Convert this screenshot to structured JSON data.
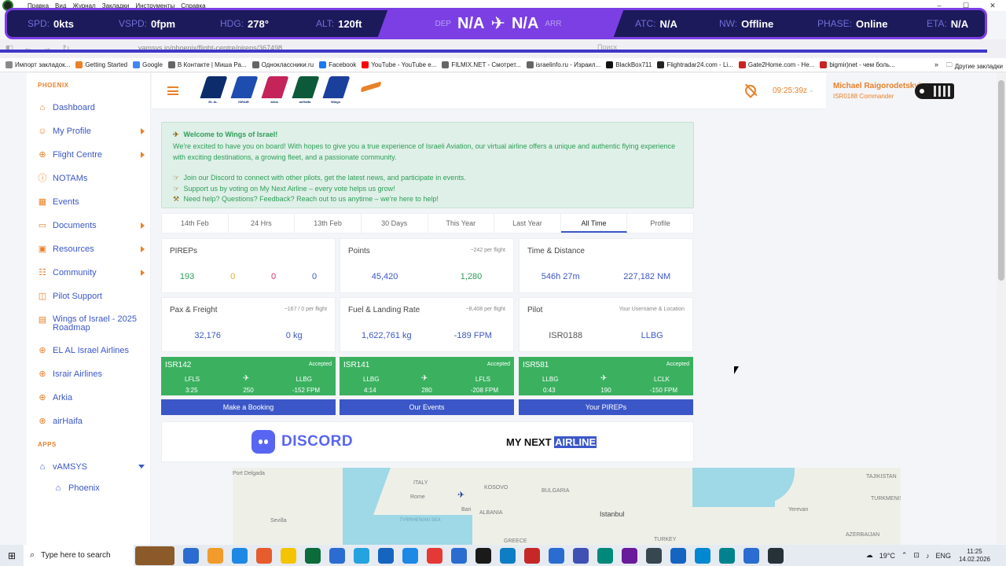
{
  "os_menu": {
    "items": [
      "Правка",
      "Вид",
      "Журнал",
      "Закладки",
      "Инструменты",
      "Справка"
    ]
  },
  "hud": {
    "spd_label": "SPD:",
    "spd_value": "0kts",
    "vspd_label": "VSPD:",
    "vspd_value": "0fpm",
    "hdg_label": "HDG:",
    "hdg_value": "278°",
    "alt_label": "ALT:",
    "alt_value": "120ft",
    "dep_label": "DEP",
    "dep_value": "N/A",
    "arr_label": "ARR",
    "arr_value": "N/A",
    "atc_label": "ATC:",
    "atc_value": "N/A",
    "nw_label": "NW:",
    "nw_value": "Offline",
    "phase_label": "PHASE:",
    "phase_value": "Online",
    "eta_label": "ETA:",
    "eta_value": "N/A"
  },
  "browser": {
    "url": "vamsys.io/phoenix/flight-centre/pireps/367498",
    "search_placeholder": "Поиск"
  },
  "bookmarks": {
    "items": [
      {
        "label": "Импорт закладок...",
        "color": "#8a8a8a"
      },
      {
        "label": "Getting Started",
        "color": "#e8812a"
      },
      {
        "label": "Google",
        "color": "#4285f4"
      },
      {
        "label": "В Контакте | Миша Ра...",
        "color": "#666666"
      },
      {
        "label": "Одноклассники.ru",
        "color": "#666666"
      },
      {
        "label": "Facebook",
        "color": "#1877f2"
      },
      {
        "label": "YouTube - YouTube е...",
        "color": "#ff0000"
      },
      {
        "label": "FILMIX.NET - Смотрет...",
        "color": "#666666"
      },
      {
        "label": "israelinfo.ru - Израил...",
        "color": "#666666"
      },
      {
        "label": "BlackBox711",
        "color": "#111111"
      },
      {
        "label": "Flightradar24.com - Li...",
        "color": "#222222"
      },
      {
        "label": "Gate2Home.com - Не...",
        "color": "#cc2222"
      },
      {
        "label": "bigmir)net - чем боль...",
        "color": "#cc2222"
      }
    ],
    "more": "»",
    "other_label": "Другие закладки"
  },
  "sidebar": {
    "section_main": "PHOENIX",
    "items": [
      {
        "label": "Dashboard",
        "icon": "home-icon",
        "arrow": false
      },
      {
        "label": "My Profile",
        "icon": "user-icon",
        "arrow": true
      },
      {
        "label": "Flight Centre",
        "icon": "globe-icon",
        "arrow": true
      },
      {
        "label": "NOTAMs",
        "icon": "alert-icon",
        "arrow": false
      },
      {
        "label": "Events",
        "icon": "calendar-icon",
        "arrow": false
      },
      {
        "label": "Documents",
        "icon": "folder-icon",
        "arrow": true
      },
      {
        "label": "Resources",
        "icon": "briefcase-icon",
        "arrow": true
      },
      {
        "label": "Community",
        "icon": "users-icon",
        "arrow": true
      },
      {
        "label": "Pilot Support",
        "icon": "support-icon",
        "arrow": false
      },
      {
        "label": "Wings of Israel - 2025 Roadmap",
        "icon": "grid-icon",
        "arrow": false
      },
      {
        "label": "EL AL Israel Airlines",
        "icon": "globe-icon",
        "arrow": false
      },
      {
        "label": "Israir Airlines",
        "icon": "globe-icon",
        "arrow": false
      },
      {
        "label": "Arkia",
        "icon": "globe-icon",
        "arrow": false
      },
      {
        "label": "airHaifa",
        "icon": "globe-icon",
        "arrow": false
      }
    ],
    "section_apps": "APPS",
    "apps": [
      {
        "label": "vAMSYS"
      },
      {
        "label": "Phoenix"
      }
    ]
  },
  "appbar": {
    "airlines": [
      {
        "name": "EL AL",
        "color": "#0d2c6c"
      },
      {
        "name": "ISRAIR",
        "color": "#1e4db0"
      },
      {
        "name": "arkia",
        "color": "#c4245a"
      },
      {
        "name": "airHaifa",
        "color": "#0d5a3a"
      },
      {
        "name": "Wings",
        "color": "#1b3f9c"
      }
    ],
    "time": "09:25:39z",
    "user_name": "Michael Raigorodetskyi",
    "user_role": "ISR0188 Commander"
  },
  "welcome": {
    "title": "Welcome to Wings of Israel!",
    "body": "We're excited to have you on board! With hopes to give you a true experience of Israeli Aviation, our virtual airline offers a unique and authentic flying experience with exciting destinations, a growing fleet, and a passionate community.",
    "line1": "Join our Discord to connect with other pilots, get the latest news, and participate in events.",
    "line2": "Support us by voting on My Next Airline – every vote helps us grow!",
    "line3": "Need help? Questions? Feedback? Reach out to us anytime – we're here to help!"
  },
  "period_tabs": {
    "items": [
      "14th Feb",
      "24 Hrs",
      "13th Feb",
      "30 Days",
      "This Year",
      "Last Year",
      "All Time",
      "Profile"
    ],
    "active": "All Time"
  },
  "stats": {
    "pireps": {
      "title": "PIREPs",
      "values": [
        {
          "v": "193",
          "color": "#2e9e58"
        },
        {
          "v": "0",
          "color": "#e8a92a"
        },
        {
          "v": "0",
          "color": "#d6336c"
        },
        {
          "v": "0",
          "color": "#3b57c7"
        }
      ]
    },
    "points": {
      "title": "Points",
      "sub": "~242 per flight",
      "values": [
        {
          "v": "45,420",
          "color": "#3b57c7"
        },
        {
          "v": "1,280",
          "color": "#2e9e58"
        }
      ]
    },
    "time_distance": {
      "title": "Time & Distance",
      "values": [
        {
          "v": "546h 27m",
          "color": "#3b57c7"
        },
        {
          "v": "227,182 NM",
          "color": "#3b57c7"
        }
      ]
    },
    "pax_freight": {
      "title": "Pax & Freight",
      "sub": "~167 / 0 per flight",
      "values": [
        {
          "v": "32,176",
          "color": "#3b57c7"
        },
        {
          "v": "0 kg",
          "color": "#3b57c7"
        }
      ]
    },
    "fuel_landing": {
      "title": "Fuel & Landing Rate",
      "sub": "~8,408 per flight",
      "values": [
        {
          "v": "1,622,761 kg",
          "color": "#3b57c7"
        },
        {
          "v": "-189 FPM",
          "color": "#3b57c7"
        }
      ]
    },
    "pilot": {
      "title": "Pilot",
      "sub": "Your Username & Location",
      "values": [
        {
          "v": "ISR0188",
          "color": "#555555"
        },
        {
          "v": "LLBG",
          "color": "#3b57c7"
        }
      ]
    }
  },
  "flights": [
    {
      "id": "ISR142",
      "status": "Accepted",
      "dep": "LFLS",
      "arr": "LLBG",
      "time": "3:25",
      "dist": "250",
      "rate": "-152 FPM"
    },
    {
      "id": "ISR141",
      "status": "Accepted",
      "dep": "LLBG",
      "arr": "LFLS",
      "time": "4:14",
      "dist": "280",
      "rate": "-208 FPM"
    },
    {
      "id": "ISR581",
      "status": "Accepted",
      "dep": "LLBG",
      "arr": "LCLK",
      "time": "0:43",
      "dist": "190",
      "rate": "-150 FPM"
    }
  ],
  "actions": {
    "booking": "Make a Booking",
    "events": "Our Events",
    "pireps": "Your PIREPs"
  },
  "promo": {
    "discord": "DISCORD",
    "mna_prefix": "MY NEXT ",
    "mna_highlight": "AIRLINE"
  },
  "map": {
    "labels": [
      {
        "t": "Port Delgada"
      },
      {
        "t": "ITALY"
      },
      {
        "t": "KOSOVO"
      },
      {
        "t": "BULGARIA"
      },
      {
        "t": "TAJIKISTAN"
      },
      {
        "t": "TURKMENISTAN"
      },
      {
        "t": "Rome"
      },
      {
        "t": "Sevilla"
      },
      {
        "t": "TYRRHENIAN SEA"
      },
      {
        "t": "Bari"
      },
      {
        "t": "ALBANIA"
      },
      {
        "t": "Istanbul"
      },
      {
        "t": "Yerevan"
      },
      {
        "t": "TURKEY"
      },
      {
        "t": "GREECE"
      },
      {
        "t": "AZERBAIJAN"
      }
    ]
  },
  "taskbar": {
    "search_placeholder": "Type here to search",
    "weather": "19°C",
    "lang": "ENG",
    "time": "11:25",
    "date": "14.02.2026"
  }
}
